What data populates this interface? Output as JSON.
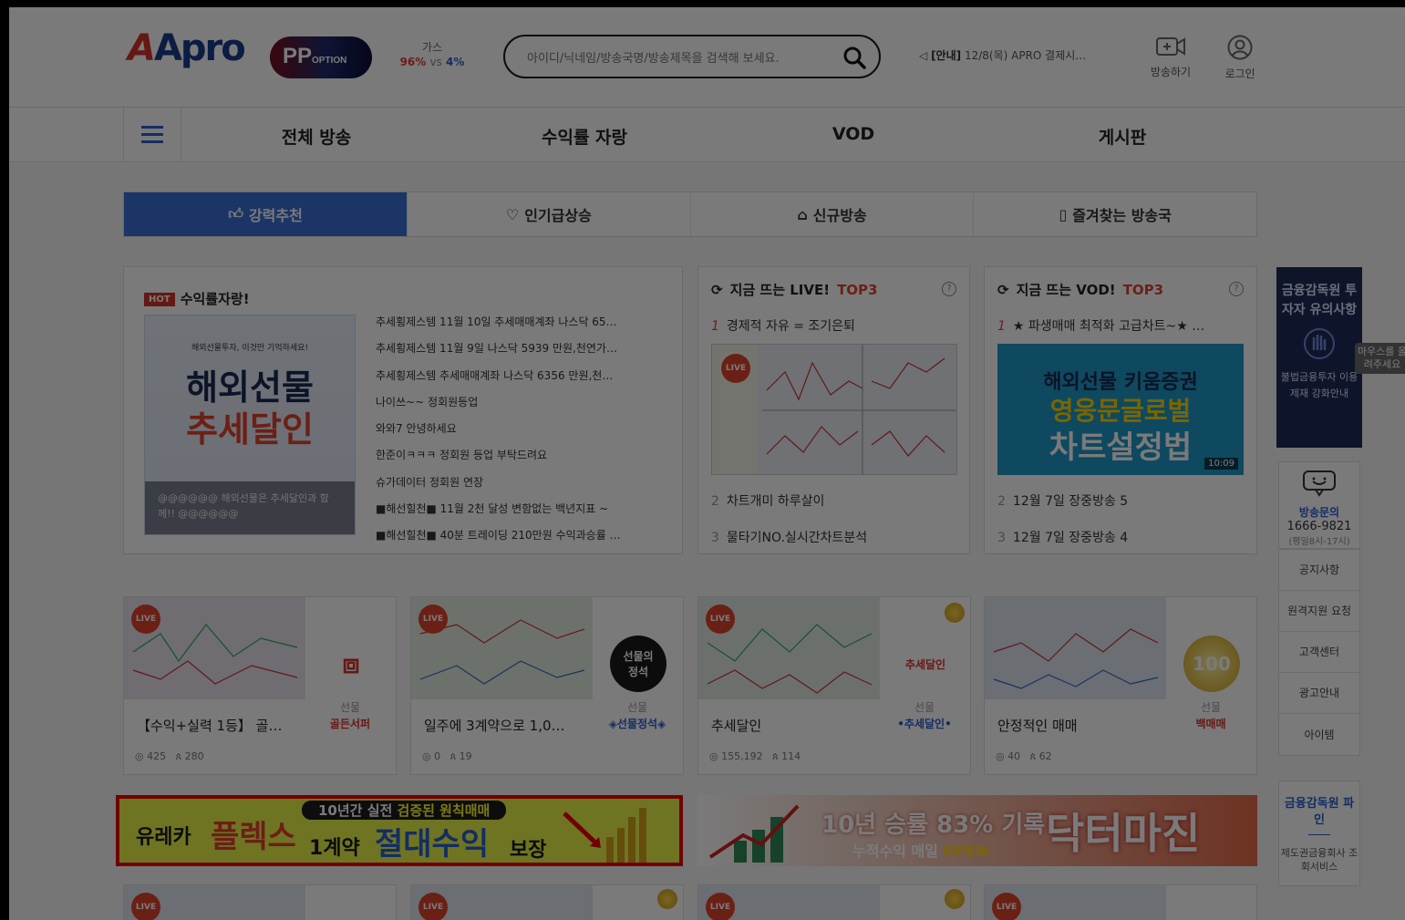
{
  "header": {
    "logo_text": "Apro",
    "badge_text": "PP",
    "badge_sub": "OPTION",
    "vote_title": "가스",
    "vote_left": "96%",
    "vote_vs": "vs",
    "vote_right": "4%",
    "search_placeholder": "아이디/닉네임/방송국명/방송제목을 검색해 보세요.",
    "notice_label": "[안내]",
    "notice_text": "12/8(목) APRO 결제시…",
    "broadcast_label": "방송하기",
    "login_label": "로그인"
  },
  "nav": {
    "items": [
      "전체 방송",
      "수익률 자랑",
      "VOD",
      "게시판"
    ]
  },
  "tabs": [
    "강력추천",
    "인기급상승",
    "신규방송",
    "즐겨찾는 방송국"
  ],
  "hot_panel": {
    "tag": "HOT",
    "title": "수익률자랑!",
    "promo_small": "해외선물투자, 이것만 기억하세요!",
    "promo_line1": "해외선물",
    "promo_line2": "추세달인",
    "promo_caption": "@@@@@@ 해외선물은 추세달인과 함께!! @@@@@@",
    "posts": [
      "추세횡제스템 11월 10일 추세매매계좌 나스닥 65…",
      "추세횡제스템 11월 9일 나스닥 5939 만원,천연가…",
      "추세횡제스템 추세매매계좌 나스닥 6356 만원,천…",
      "나이쓰~~ 정회원등업",
      "와와7 안녕하세요",
      "한준이ㅋㅋㅋ 정회원 등업 부탁드려요",
      "슈가데이터 정회원 연장",
      "■해선힐천■ 11월 2천 달성 변함없는 백년지표 ~",
      "■해선힐천■ 40분 트레이딩 210만원 수익과승률 …"
    ]
  },
  "live_top3": {
    "title": "지금 뜨는 LIVE!",
    "top": "TOP3",
    "help": "?",
    "rank1_num": "1",
    "rank1": "경제적 자유 = 조기은퇴",
    "live_badge": "LIVE",
    "rank2_num": "2",
    "rank2": "차트개미 하루살이",
    "rank3_num": "3",
    "rank3": "물타기NO.실시간차트분석"
  },
  "vod_top3": {
    "title": "지금 뜨는 VOD!",
    "top": "TOP3",
    "help": "?",
    "rank1_num": "1",
    "rank1": "★ 파생매매 최적화 고급차트~★ …",
    "img_line1": "해외선물 키움증권",
    "img_line2": "영웅문글로벌",
    "img_line3": "차트설정법",
    "duration": "10:09",
    "rank2_num": "2",
    "rank2": "12월 7일 장중방송 5",
    "rank3_num": "3",
    "rank3": "12월 7일 장중방송 4"
  },
  "cards": [
    {
      "live": "LIVE",
      "title": "【수익+실력 1등】 골…",
      "cat": "선물",
      "host": "골든서퍼",
      "views": "425",
      "fans": "280",
      "avatar": "골든"
    },
    {
      "live": "LIVE",
      "title": "일주에 3계약으로 1,0…",
      "cat": "선물",
      "host": "◈선물정석◈",
      "views": "0",
      "fans": "19",
      "avatar": "선물의\n정석"
    },
    {
      "live": "LIVE",
      "title": "추세달인",
      "cat": "선물",
      "host": "•추세달인•",
      "views": "155,192",
      "fans": "114",
      "avatar": "추세달인"
    },
    {
      "live": "LIVE",
      "title": "안정적인 매매",
      "cat": "선물",
      "host": "백매매",
      "views": "40",
      "fans": "62",
      "avatar": "100"
    }
  ],
  "banner1": {
    "top_a": "10년간 실전",
    "top_b": "검증된 원칙매매",
    "a": "유레카",
    "b": "플렉스",
    "c": "1계약",
    "d": "절대수익",
    "e": "보장"
  },
  "banner2": {
    "t1": "10년 승률 83% 기록",
    "t2a": "누적수익 매일",
    "t2b": "OPEN",
    "t3": "닥터마진"
  },
  "sidebar": {
    "fss_title": "금융감독원 투자자 유의사항",
    "fss_body": "불법금융투자 이용제재 강화안내",
    "tip": "마우스를 올려주세요",
    "contact_title": "방송문의",
    "contact_phone": "1666-9821",
    "contact_hours": "(평일8시-17시)",
    "links": [
      "공지사항",
      "원격지원 요청",
      "고객센터",
      "광고안내",
      "아이템"
    ],
    "fine_title": "금융감독원 파인",
    "fine_sub": "제도권금융회사 조회서비스"
  },
  "colors": {
    "accent_blue": "#3a6fd8",
    "hot_red": "#d6332b",
    "sidebar_navy": "#1f2c58",
    "banner_yellow": "#e8f24a"
  }
}
